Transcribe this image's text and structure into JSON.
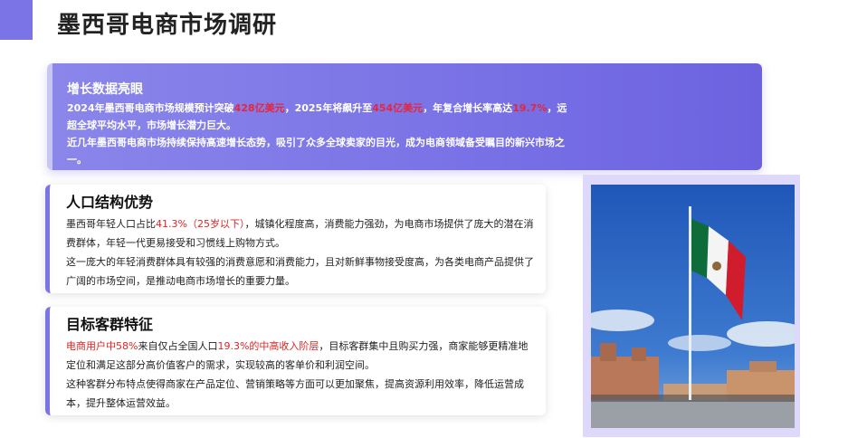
{
  "title": "墨西哥电商市场调研",
  "hero": {
    "heading": "增长数据亮眼",
    "p1_a": "2024年墨西哥电商市场规模预计突破",
    "p1_h1": "428亿美元",
    "p1_b": "，2025年将飙升至",
    "p1_h2": "454亿美元",
    "p1_c": "，年复合增长率高达",
    "p1_h3": "19.7%",
    "p1_d": "，远超全球平均水平，市场增长潜力巨大。",
    "p2": "近几年墨西哥电商市场持续保持高速增长态势，吸引了众多全球卖家的目光，成为电商领域备受瞩目的新兴市场之一。"
  },
  "population": {
    "heading": "人口结构优势",
    "p1_a": "墨西哥年轻人口占比",
    "p1_h": "41.3%（25岁以下）",
    "p1_b": "，城镇化程度高，消费能力强劲，为电商市场提供了庞大的潜在消费群体，年轻一代更易接受和习惯线上购物方式。",
    "p2": "这一庞大的年轻消费群体具有较强的消费意愿和消费能力，且对新鲜事物接受度高，为各类电商产品提供了广阔的市场空间，是推动电商市场增长的重要力量。"
  },
  "customers": {
    "heading": "目标客群特征",
    "p1_h1": "电商用户中58%",
    "p1_a": "来自仅占全国人口",
    "p1_h2": "19.3%的中高收入阶层",
    "p1_b": "，目标客群集中且购买力强，商家能够更精准地定位和满足这部分高价值客户的需求，实现较高的客单价和利润空间。",
    "p2": "这种客群分布特点使得商家在产品定位、营销策略等方面可以更加聚焦，提高资源利用效率，降低运营成本，提升整体运营效益。"
  },
  "colors": {
    "accent": "#7b74e6",
    "highlight": "#e8253a"
  }
}
